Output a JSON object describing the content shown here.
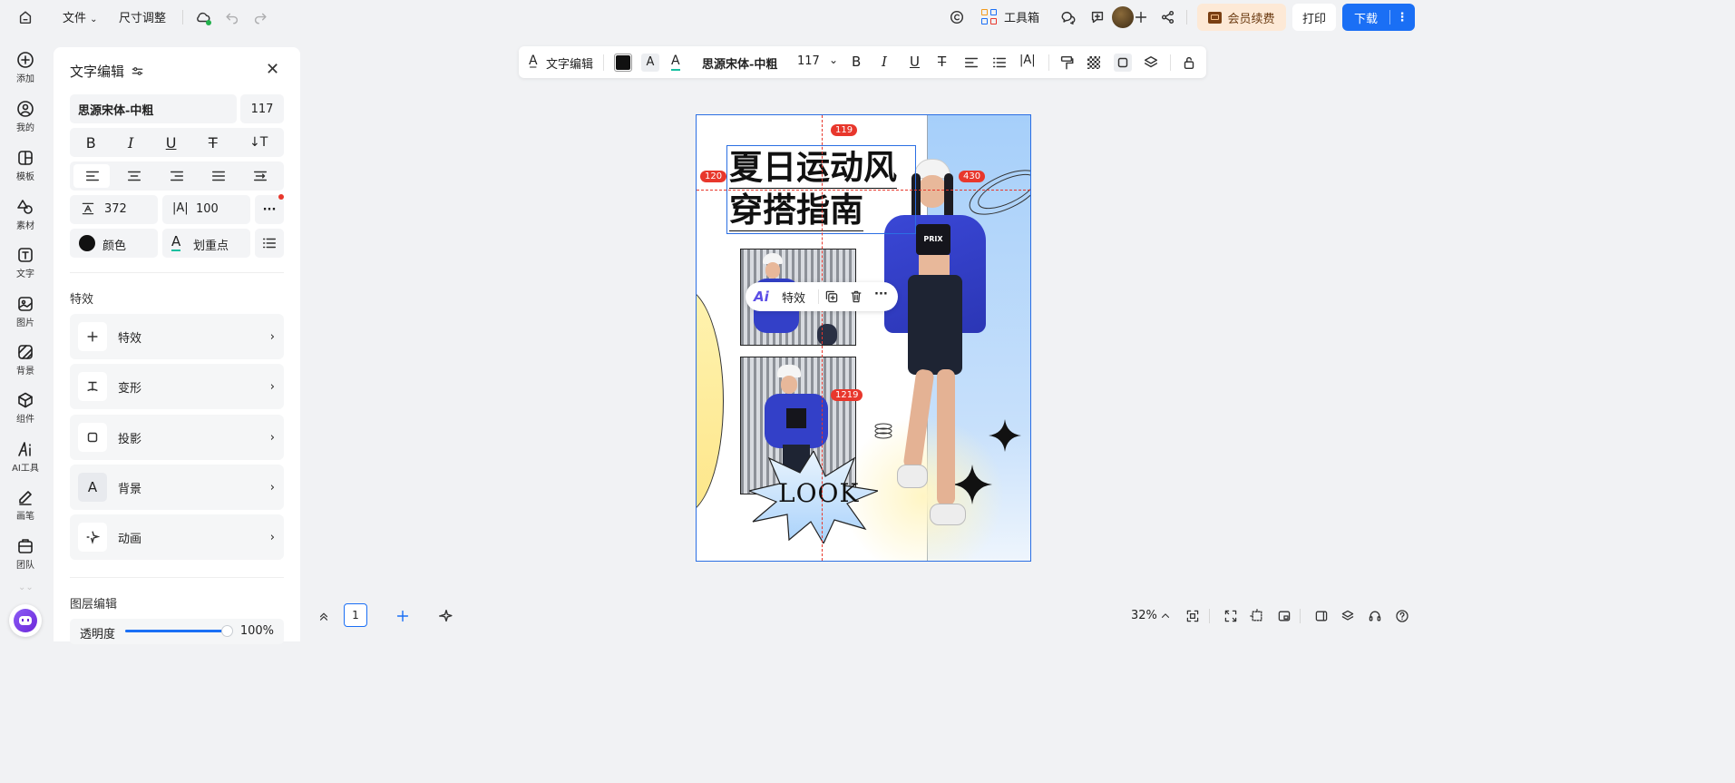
{
  "topbar": {
    "file_menu": "文件",
    "resize": "尺寸调整",
    "toolbox": "工具箱",
    "vip": "会员续费",
    "print": "打印",
    "download": "下载"
  },
  "rail": [
    {
      "label": "添加",
      "icon": "plus-circle-icon"
    },
    {
      "label": "我的",
      "icon": "user-icon"
    },
    {
      "label": "模板",
      "icon": "template-icon"
    },
    {
      "label": "素材",
      "icon": "shapes-icon"
    },
    {
      "label": "文字",
      "icon": "text-icon"
    },
    {
      "label": "图片",
      "icon": "image-icon"
    },
    {
      "label": "背景",
      "icon": "background-icon"
    },
    {
      "label": "组件",
      "icon": "component-icon"
    },
    {
      "label": "AI工具",
      "icon": "ai-icon"
    },
    {
      "label": "画笔",
      "icon": "pen-icon"
    },
    {
      "label": "团队",
      "icon": "team-icon"
    }
  ],
  "panel": {
    "title": "文字编辑",
    "font_name": "思源宋体-中粗",
    "font_size": "117",
    "line_height": "372",
    "letter_spacing": "100",
    "color_label": "颜色",
    "highlight_label": "划重点",
    "effects_section": "特效",
    "effects": [
      {
        "label": "特效",
        "icon": "plus-icon"
      },
      {
        "label": "变形",
        "icon": "warp-icon"
      },
      {
        "label": "投影",
        "icon": "shadow-icon"
      },
      {
        "label": "背景",
        "icon": "text-bg-icon"
      },
      {
        "label": "动画",
        "icon": "animation-icon"
      }
    ],
    "layer_section": "图层编辑",
    "opacity_label": "透明度",
    "opacity_value": "100%",
    "opacity_fraction": 1.0
  },
  "text_toolbar": {
    "edit_label": "文字编辑",
    "font_name": "思源宋体-中粗",
    "font_size": "117",
    "text_color": "#111111"
  },
  "canvas": {
    "headline_line1": "夏日运动风",
    "headline_line2": "穿搭指南",
    "badge_top": "119",
    "badge_left": "120",
    "badge_right": "430",
    "badge_bottom": "1219",
    "look_text": "LOOK",
    "shirt_text": "PRIX"
  },
  "floating_toolbar": {
    "ai_label": "Ai",
    "effect_label": "特效"
  },
  "bottom": {
    "page_number": "1",
    "zoom": "32%"
  },
  "colors": {
    "accent": "#1a6ff5",
    "badge": "#e8372c",
    "vip_bg": "#fde9d6",
    "panel_blue": "#a9d2fb"
  }
}
